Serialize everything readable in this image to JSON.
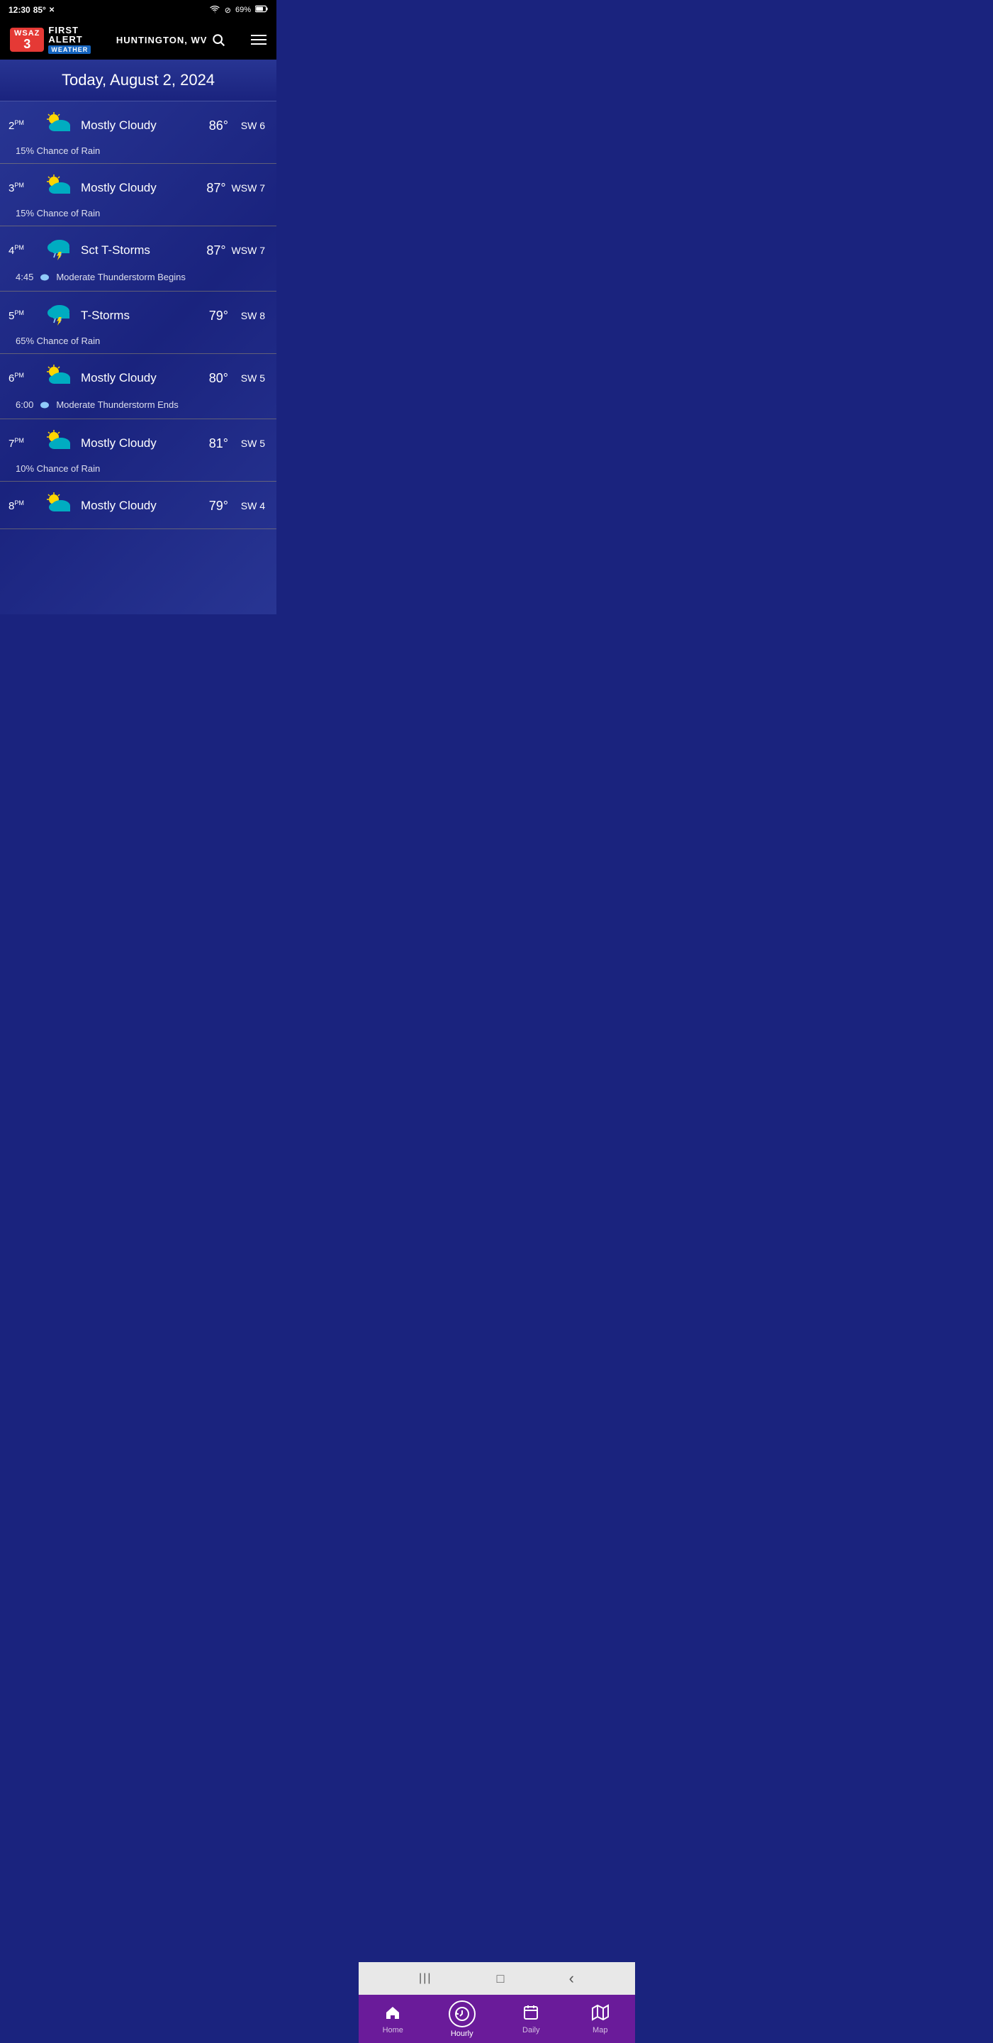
{
  "statusBar": {
    "time": "12:30",
    "temp": "85°",
    "battery": "69%"
  },
  "header": {
    "location": "HUNTINGTON, WV",
    "logoWsaz": "WSAZ",
    "logoNum": "3",
    "logoFirst": "FIRST",
    "logoAlert": "ALERT",
    "logoWeather": "WEATHER"
  },
  "dateBar": {
    "text": "Today, August 2, 2024"
  },
  "hourlyEntries": [
    {
      "time": "2",
      "ampm": "PM",
      "icon": "⛅",
      "condition": "Mostly Cloudy",
      "temp": "86°",
      "wind": "SW 6",
      "subText": "15% Chance of Rain",
      "subTime": "",
      "alertText": ""
    },
    {
      "time": "3",
      "ampm": "PM",
      "icon": "⛅",
      "condition": "Mostly Cloudy",
      "temp": "87°",
      "wind": "WSW 7",
      "subText": "15% Chance of Rain",
      "subTime": "",
      "alertText": ""
    },
    {
      "time": "4",
      "ampm": "PM",
      "icon": "⛈",
      "condition": "Sct T-Storms",
      "temp": "87°",
      "wind": "WSW 7",
      "subText": "",
      "subTime": "4:45",
      "alertText": "Moderate Thunderstorm Begins"
    },
    {
      "time": "5",
      "ampm": "PM",
      "icon": "⛈",
      "condition": "T-Storms",
      "temp": "79°",
      "wind": "SW 8",
      "subText": "65% Chance of Rain",
      "subTime": "",
      "alertText": ""
    },
    {
      "time": "6",
      "ampm": "PM",
      "icon": "⛅",
      "condition": "Mostly Cloudy",
      "temp": "80°",
      "wind": "SW 5",
      "subText": "",
      "subTime": "6:00",
      "alertText": "Moderate Thunderstorm Ends"
    },
    {
      "time": "7",
      "ampm": "PM",
      "icon": "⛅",
      "condition": "Mostly Cloudy",
      "temp": "81°",
      "wind": "SW 5",
      "subText": "10% Chance of Rain",
      "subTime": "",
      "alertText": ""
    },
    {
      "time": "8",
      "ampm": "PM",
      "icon": "⛅",
      "condition": "Mostly Cloudy",
      "temp": "79°",
      "wind": "SW 4",
      "subText": "",
      "subTime": "",
      "alertText": ""
    }
  ],
  "bottomNav": {
    "items": [
      {
        "label": "Home",
        "icon": "🏠",
        "active": false
      },
      {
        "label": "Hourly",
        "icon": "◀",
        "active": true
      },
      {
        "label": "Daily",
        "icon": "📅",
        "active": false
      },
      {
        "label": "Map",
        "icon": "🗺",
        "active": false
      }
    ]
  },
  "sysNav": {
    "back": "‹",
    "home": "□",
    "recent": "|||"
  }
}
